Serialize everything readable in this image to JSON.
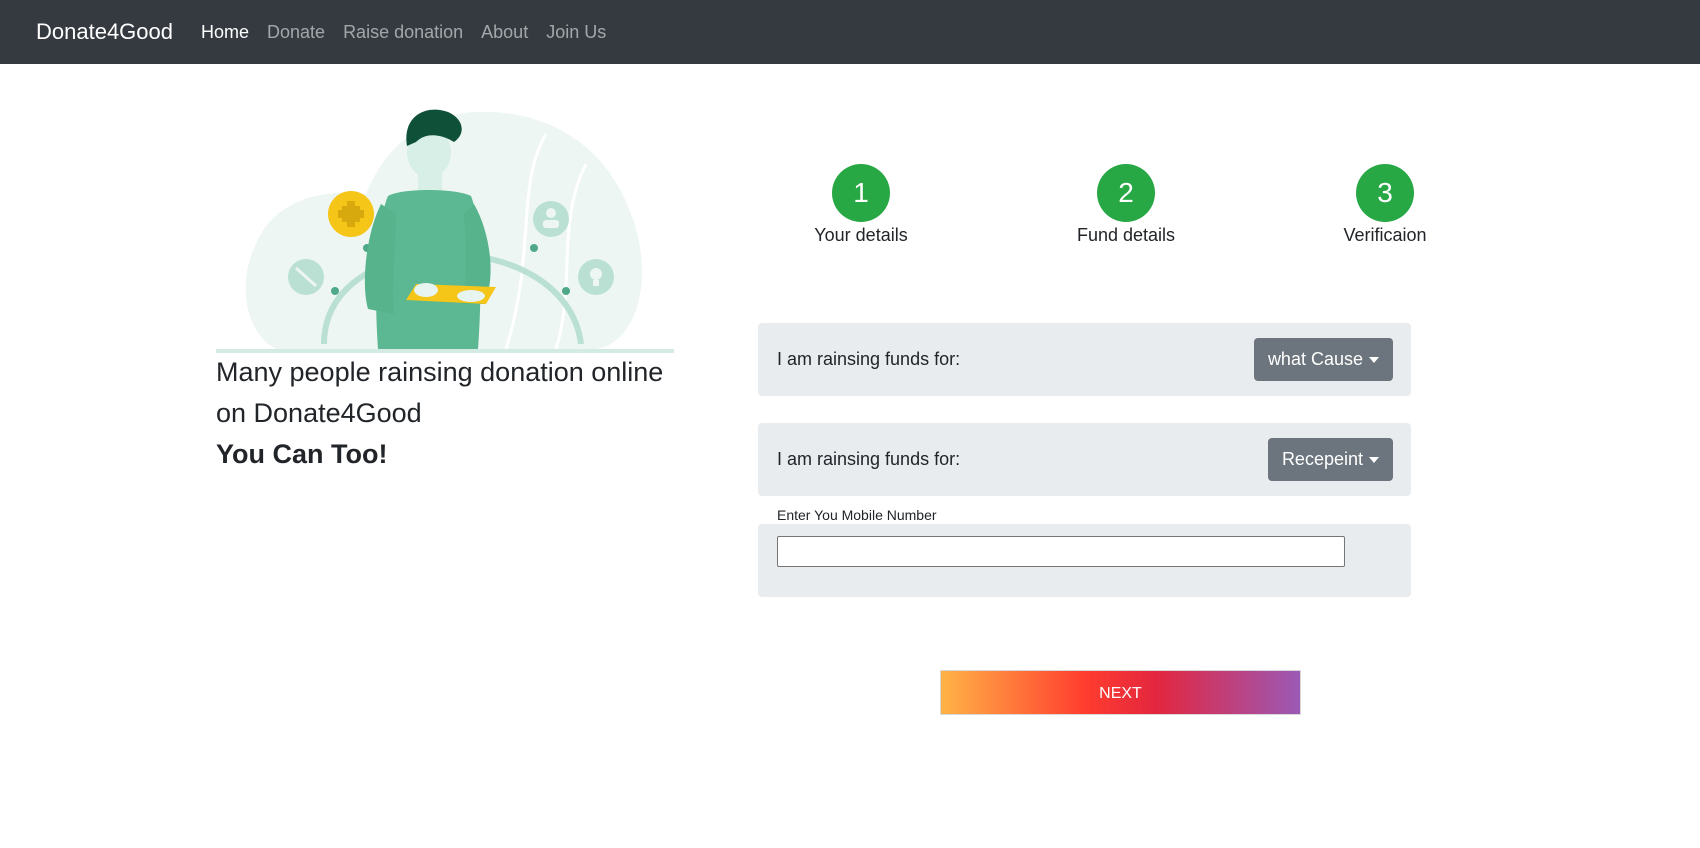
{
  "navbar": {
    "brand": "Donate4Good",
    "links": [
      "Home",
      "Donate",
      "Raise donation",
      "About",
      "Join Us"
    ],
    "active": "Home"
  },
  "hero": {
    "line1": "Many people rainsing donation online on Donate4Good",
    "line2": "You Can Too!"
  },
  "steps": [
    {
      "number": "1",
      "label": "Your details"
    },
    {
      "number": "2",
      "label": "Fund details"
    },
    {
      "number": "3",
      "label": "Verificaion"
    }
  ],
  "form": {
    "cause_label": "I am rainsing funds for:",
    "cause_button": "what Cause",
    "recipient_label": "I am rainsing funds for:",
    "recipient_button": "Recepeint",
    "mobile_label": "Enter You Mobile Number",
    "mobile_value": "",
    "next_label": "NEXT"
  },
  "colors": {
    "navbar": "#343a40",
    "step_circle": "#28a745",
    "dropdown": "#6c757d",
    "panel": "#e9ecef"
  }
}
